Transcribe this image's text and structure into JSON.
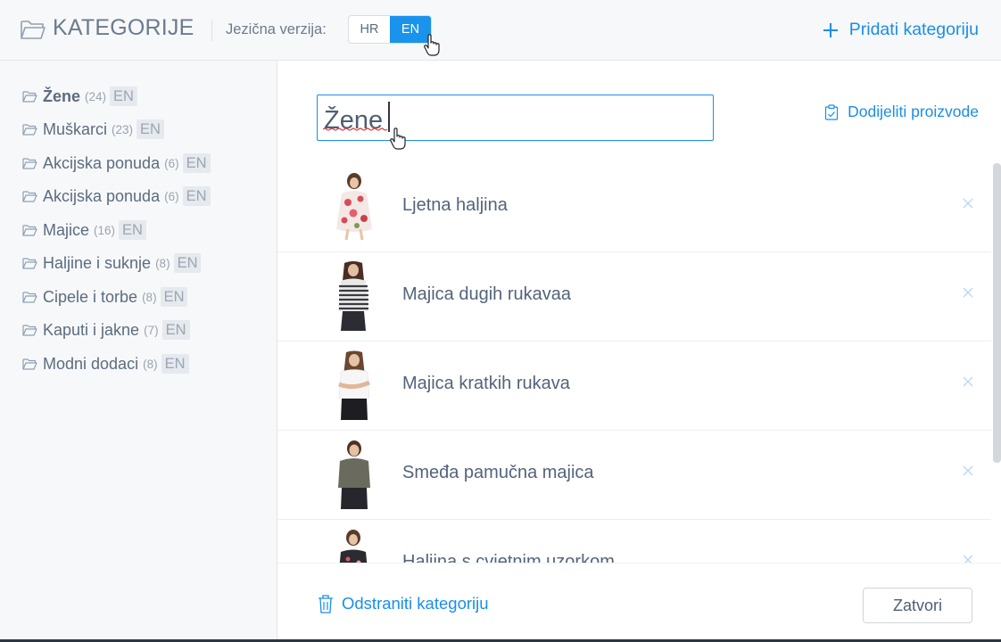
{
  "header": {
    "title": "KATEGORIJE",
    "language_label": "Jezična verzija:",
    "languages": [
      "HR",
      "EN"
    ],
    "active_language": "EN",
    "add_category_label": "Pridati kategoriju",
    "folder_icon": "folder-open-icon",
    "plus_icon": "plus-icon"
  },
  "sidebar": {
    "categories": [
      {
        "name": "Žene",
        "count": "(24)",
        "lang": "EN",
        "selected": true
      },
      {
        "name": "Muškarci",
        "count": "(23)",
        "lang": "EN"
      },
      {
        "name": "Akcijska ponuda",
        "count": "(6)",
        "lang": "EN"
      },
      {
        "name": "Akcijska ponuda",
        "count": "(6)",
        "lang": "EN"
      },
      {
        "name": "Majice",
        "count": "(16)",
        "lang": "EN"
      },
      {
        "name": "Haljine i suknje",
        "count": "(8)",
        "lang": "EN"
      },
      {
        "name": "Cipele i torbe",
        "count": "(8)",
        "lang": "EN"
      },
      {
        "name": "Kaputi i jakne",
        "count": "(7)",
        "lang": "EN"
      },
      {
        "name": "Modni dodaci",
        "count": "(8)",
        "lang": "EN"
      }
    ]
  },
  "main": {
    "category_name_value": "Žene",
    "assign_products_label": "Dodijeliti proizvode",
    "products": [
      {
        "name": "Ljetna haljina"
      },
      {
        "name": "Majica dugih rukavaa"
      },
      {
        "name": "Majica kratkih rukava"
      },
      {
        "name": "Smeđa pamučna majica"
      },
      {
        "name": "Haljina s cvjetnim uzorkom"
      }
    ],
    "delete_category_label": "Odstraniti kategoriju",
    "close_label": "Zatvori"
  },
  "colors": {
    "accent": "#1a8ee8",
    "toggle_active": "#1a93ec",
    "sidebar_bg": "#f7f8f9",
    "text": "#5c6c80"
  }
}
